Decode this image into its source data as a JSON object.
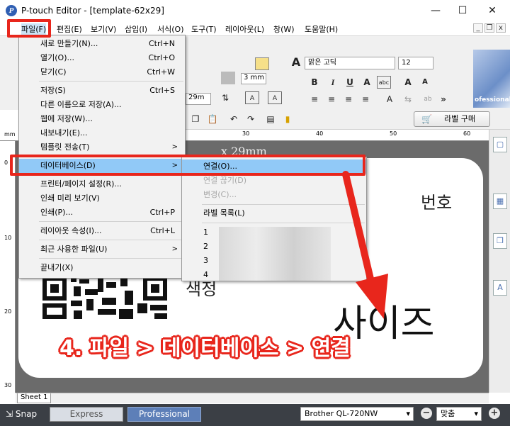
{
  "window": {
    "title": "P-touch Editor - [template-62x29]",
    "minimize": "—",
    "maximize": "☐",
    "close": "✕"
  },
  "menubar": {
    "items": [
      "파일(F)",
      "편집(E)",
      "보기(V)",
      "삽입(I)",
      "서식(O)",
      "도구(T)",
      "레이아웃(L)",
      "창(W)",
      "도움말(H)"
    ],
    "mdi": [
      "_",
      "❐",
      "x"
    ]
  },
  "toolbar": {
    "font_name": "맑은 고딕",
    "font_size": "12",
    "width_value": "3 mm",
    "tape_value": "29m",
    "bold": "B",
    "italic": "I",
    "underline": "U",
    "letter_a": "A",
    "pro_banner": "ofessional",
    "buy_label": "라벨 구매"
  },
  "ruler": {
    "h_marks": [
      "30",
      "40",
      "50",
      "60"
    ],
    "v_marks": [
      "0",
      "10",
      "20",
      "30"
    ],
    "unit": "mm"
  },
  "canvas": {
    "label_size": "x 29mm",
    "text_bunho": "번호",
    "text_saizeu": "사이즈",
    "text_saekjeong": "색정"
  },
  "file_menu": {
    "items": [
      {
        "label": "새로 만들기(N)...",
        "shortcut": "Ctrl+N"
      },
      {
        "label": "열기(O)...",
        "shortcut": "Ctrl+O"
      },
      {
        "label": "닫기(C)",
        "shortcut": "Ctrl+W"
      },
      {
        "label": "저장(S)",
        "shortcut": "Ctrl+S"
      },
      {
        "label": "다른 이름으로 저장(A)..."
      },
      {
        "label": "웹에 저장(W)..."
      },
      {
        "label": "내보내기(E)..."
      },
      {
        "label": "템플릿 전송(T)",
        "arrow": ">"
      },
      {
        "label": "데이터베이스(D)",
        "arrow": ">"
      },
      {
        "label": "프린터/페이지 설정(R)..."
      },
      {
        "label": "인쇄 미리 보기(V)"
      },
      {
        "label": "인쇄(P)...",
        "shortcut": "Ctrl+P"
      },
      {
        "label": "레이아웃 속성(I)...",
        "shortcut": "Ctrl+L"
      },
      {
        "label": "최근 사용한 파일(U)",
        "arrow": ">"
      },
      {
        "label": "끝내기(X)"
      }
    ]
  },
  "db_submenu": {
    "items": [
      {
        "label": "연결(O)..."
      },
      {
        "label": "연결 끊기(D)"
      },
      {
        "label": "변경(C)..."
      },
      {
        "label": "라벨 목록(L)"
      }
    ],
    "recent": [
      "1",
      "2",
      "3",
      "4"
    ]
  },
  "sheet_tab": "Sheet 1",
  "statusbar": {
    "snap": "Snap",
    "express": "Express",
    "professional": "Professional",
    "printer": "Brother QL-720NW",
    "zoom": "맞춤",
    "zoom_minus": "−",
    "zoom_plus": "+"
  },
  "annotation": "4. 파일 > 데이터베이스 > 연결",
  "colors": {
    "annotation_red": "#e8261c",
    "menu_highlight": "#91c9f7",
    "status_bar": "#3b3f45",
    "pro_button": "#5d7fb8"
  }
}
